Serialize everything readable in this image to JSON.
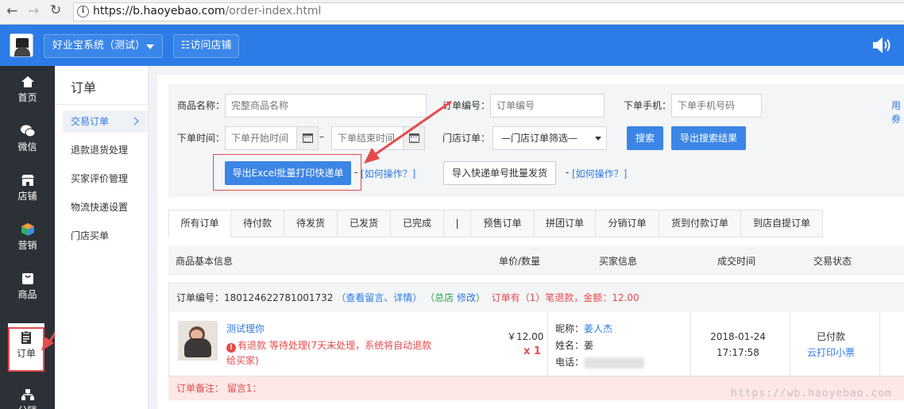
{
  "browser": {
    "url_host": "https://b.haoyebao.com",
    "url_path": "/order-index.html"
  },
  "header": {
    "system_name": "好业宝系统（测试）",
    "visit_store": "☷访问店铺"
  },
  "sidebar": {
    "items": [
      {
        "label": "首页",
        "icon": "home-icon"
      },
      {
        "label": "微信",
        "icon": "wechat-icon"
      },
      {
        "label": "店铺",
        "icon": "store-icon"
      },
      {
        "label": "营销",
        "icon": "marketing-icon"
      },
      {
        "label": "商品",
        "icon": "goods-icon"
      },
      {
        "label": "订单",
        "icon": "order-icon",
        "active": true
      },
      {
        "label": "分销",
        "icon": "distribution-icon"
      }
    ]
  },
  "subnav": {
    "title": "订单",
    "items": [
      "交易订单",
      "退款退货处理",
      "买家评价管理",
      "物流快递设置",
      "门店买单"
    ]
  },
  "filters": {
    "product_name_label": "商品名称：",
    "product_name_placeholder": "完整商品名称",
    "order_no_label": "订单编号：",
    "order_no_placeholder": "订单编号",
    "phone_label": "下单手机：",
    "phone_placeholder": "下单手机号码",
    "time_label": "下单时间：",
    "start_placeholder": "下单开始时间",
    "dash": "–",
    "end_placeholder": "下单结束时间",
    "store_label": "门店订单：",
    "store_select": "—门店订单筛选—",
    "search_btn": "搜索",
    "export_result_btn": "导出搜索结果",
    "export_excel_btn": "导出Excel批量打印快递单",
    "help_link": "[如何操作？]",
    "import_btn": "导入快递单号批量发货",
    "right_cut_text": "用券"
  },
  "tabs": [
    "所有订单",
    "待付款",
    "待发货",
    "已发货",
    "已完成",
    "|",
    "预售订单",
    "拼团订单",
    "分销订单",
    "货到付款订单",
    "到店自提订单"
  ],
  "table_header": {
    "product": "商品基本信息",
    "price": "单价/数量",
    "buyer": "买家信息",
    "time": "成交时间",
    "status": "交易状态"
  },
  "order": {
    "no_label": "订单编号：",
    "no": "180124622781001732",
    "view_link": "（查看留言、详情）",
    "store_open": "（",
    "store": "总店",
    "edit": "修改",
    "store_close": "）",
    "refund_info": "订单有（1）笔退款，金额：12.00",
    "product_name": "测试理你",
    "refund_note": "有退款 等待处理(7天未处理，系统将自动退款给买家)",
    "price": "￥12.00",
    "qty": "x 1",
    "nickname_label": "昵称：",
    "nickname": "姜人杰",
    "name_label": "姓名：",
    "name": "姜",
    "phone_label": "电话：",
    "time": "2018-01-24 17:17:58",
    "status": "已付款",
    "print_link": "云打印小票",
    "remark": "订单备注：  留言1："
  },
  "watermark": "https://wb.haoyebao.com",
  "colors": {
    "primary": "#2d7be6",
    "sidebar": "#2c3138",
    "danger": "#e54b4b"
  }
}
